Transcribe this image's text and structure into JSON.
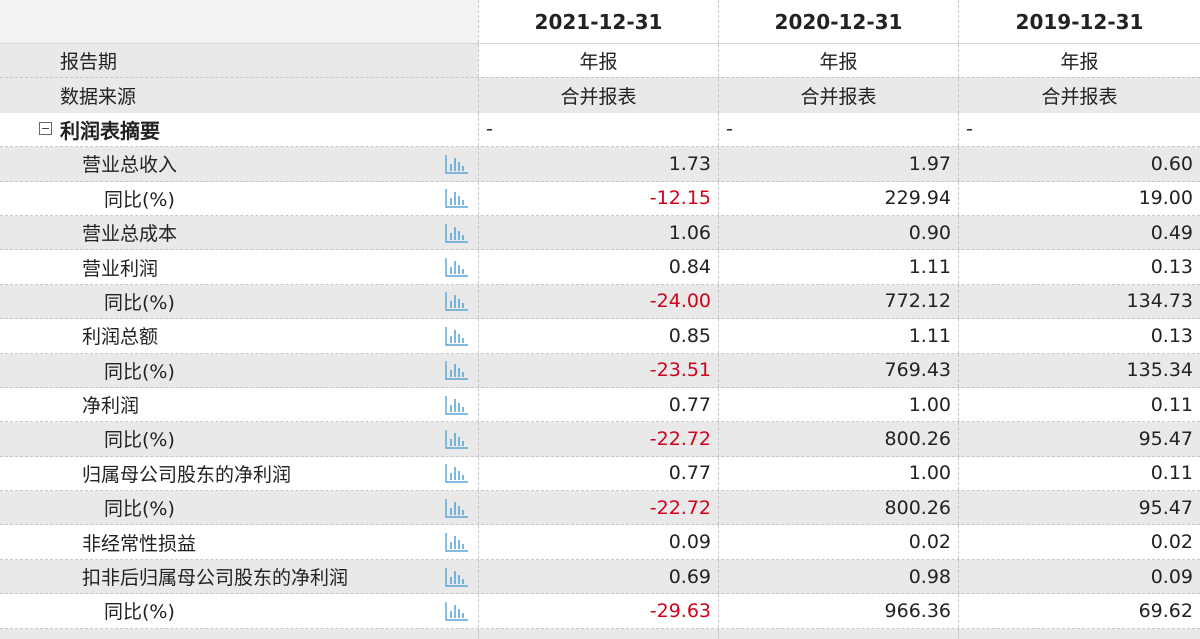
{
  "header": {
    "dates": [
      "2021-12-31",
      "2020-12-31",
      "2019-12-31"
    ]
  },
  "meta_rows": [
    {
      "label": "报告期",
      "values": [
        "年报",
        "年报",
        "年报"
      ]
    },
    {
      "label": "数据来源",
      "values": [
        "合并报表",
        "合并报表",
        "合并报表"
      ]
    }
  ],
  "section": {
    "label": "利润表摘要",
    "values": [
      "-",
      "-",
      "-"
    ],
    "toggle_icon": "collapse-minus-icon"
  },
  "rows": [
    {
      "label": "营业总收入",
      "level": 1,
      "values": [
        "1.73",
        "1.97",
        "0.60"
      ],
      "neg": [
        false,
        false,
        false
      ]
    },
    {
      "label": "同比(%)",
      "level": 2,
      "values": [
        "-12.15",
        "229.94",
        "19.00"
      ],
      "neg": [
        true,
        false,
        false
      ]
    },
    {
      "label": "营业总成本",
      "level": 1,
      "values": [
        "1.06",
        "0.90",
        "0.49"
      ],
      "neg": [
        false,
        false,
        false
      ]
    },
    {
      "label": "营业利润",
      "level": 1,
      "values": [
        "0.84",
        "1.11",
        "0.13"
      ],
      "neg": [
        false,
        false,
        false
      ]
    },
    {
      "label": "同比(%)",
      "level": 2,
      "values": [
        "-24.00",
        "772.12",
        "134.73"
      ],
      "neg": [
        true,
        false,
        false
      ]
    },
    {
      "label": "利润总额",
      "level": 1,
      "values": [
        "0.85",
        "1.11",
        "0.13"
      ],
      "neg": [
        false,
        false,
        false
      ]
    },
    {
      "label": "同比(%)",
      "level": 2,
      "values": [
        "-23.51",
        "769.43",
        "135.34"
      ],
      "neg": [
        true,
        false,
        false
      ]
    },
    {
      "label": "净利润",
      "level": 1,
      "values": [
        "0.77",
        "1.00",
        "0.11"
      ],
      "neg": [
        false,
        false,
        false
      ]
    },
    {
      "label": "同比(%)",
      "level": 2,
      "values": [
        "-22.72",
        "800.26",
        "95.47"
      ],
      "neg": [
        true,
        false,
        false
      ]
    },
    {
      "label": "归属母公司股东的净利润",
      "level": 1,
      "values": [
        "0.77",
        "1.00",
        "0.11"
      ],
      "neg": [
        false,
        false,
        false
      ]
    },
    {
      "label": "同比(%)",
      "level": 2,
      "values": [
        "-22.72",
        "800.26",
        "95.47"
      ],
      "neg": [
        true,
        false,
        false
      ]
    },
    {
      "label": "非经常性损益",
      "level": 1,
      "values": [
        "0.09",
        "0.02",
        "0.02"
      ],
      "neg": [
        false,
        false,
        false
      ]
    },
    {
      "label": "扣非后归属母公司股东的净利润",
      "level": 1,
      "values": [
        "0.69",
        "0.98",
        "0.09"
      ],
      "neg": [
        false,
        false,
        false
      ]
    },
    {
      "label": "同比(%)",
      "level": 2,
      "values": [
        "-29.63",
        "966.36",
        "69.62"
      ],
      "neg": [
        true,
        false,
        false
      ]
    }
  ],
  "icons": {
    "row_chart": "bar-chart-icon"
  },
  "colors": {
    "negative": "#d0021b",
    "row_gray": "#e9e9e9",
    "chart_icon": "#5aa6d6"
  }
}
